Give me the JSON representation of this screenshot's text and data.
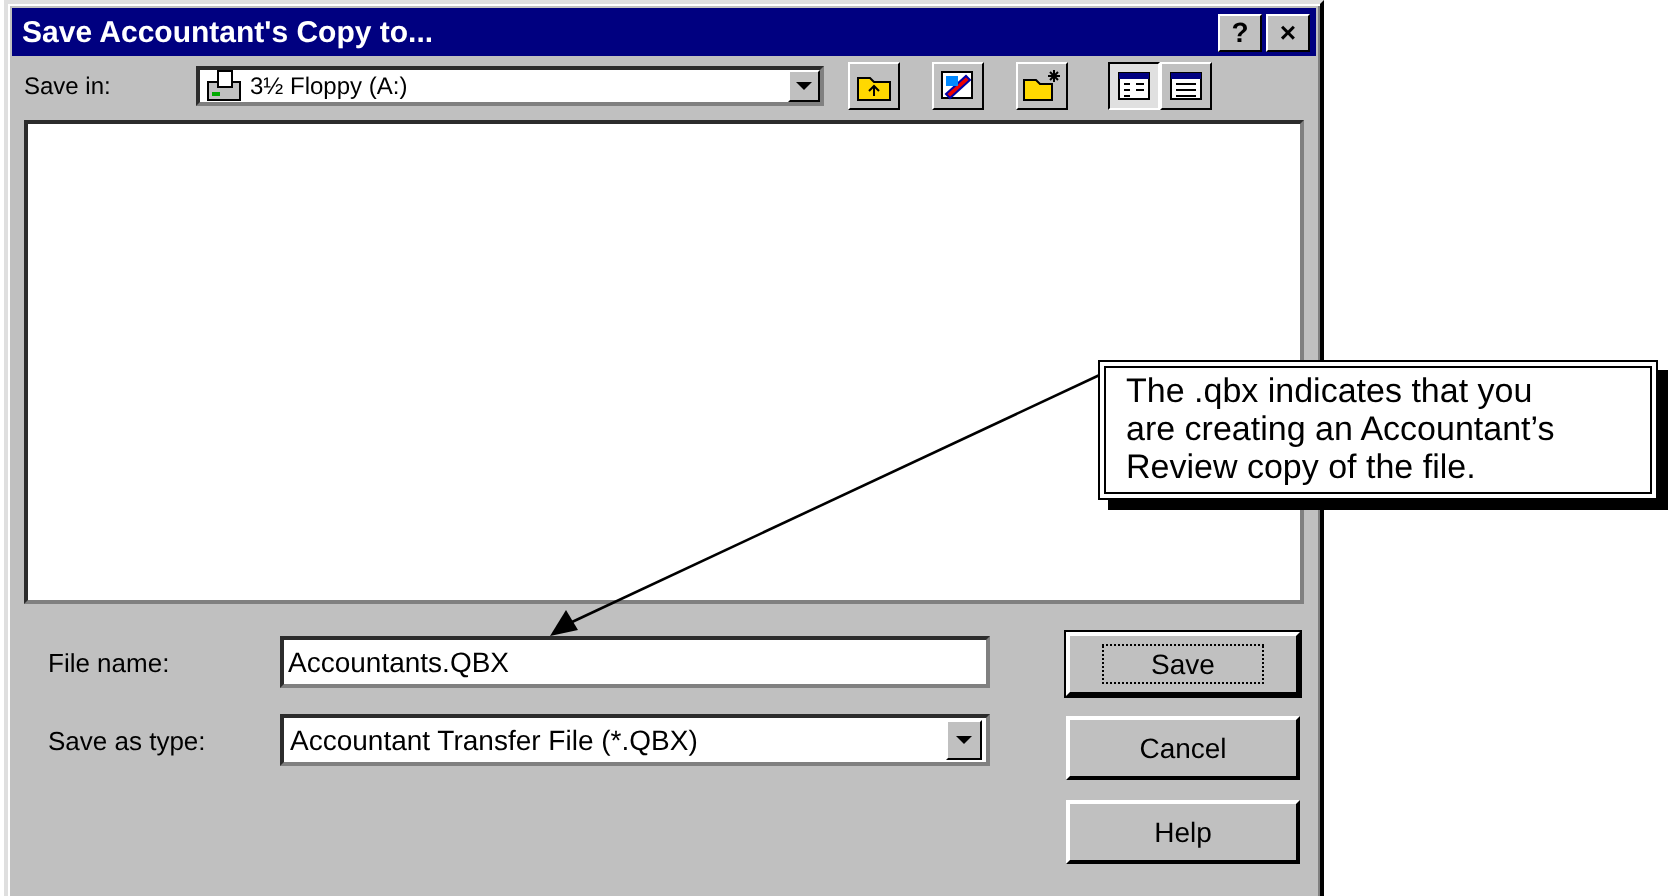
{
  "window": {
    "title": "Save Accountant's Copy to...",
    "title_buttons": [
      "?",
      "×"
    ]
  },
  "save_in": {
    "label": "Save in:",
    "value": "3½ Floppy (A:)"
  },
  "toolbar": [
    {
      "kind": "up-folder",
      "selected": false
    },
    {
      "kind": "desktop",
      "selected": false
    },
    {
      "kind": "new-folder",
      "selected": false
    },
    {
      "kind": "list-view",
      "selected": true
    },
    {
      "kind": "details-view",
      "selected": false
    }
  ],
  "file_name": {
    "label": "File name:",
    "value": "Accountants.QBX"
  },
  "save_as_type": {
    "label": "Save as type:",
    "value": "Accountant Transfer File (*.QBX)"
  },
  "buttons": [
    {
      "label": "Save",
      "default": true
    },
    {
      "label": "Cancel",
      "default": false
    },
    {
      "label": "Help",
      "default": false
    }
  ],
  "callout": {
    "text": "The .qbx indicates that you are creating an Accountant’s Review copy of the file."
  }
}
